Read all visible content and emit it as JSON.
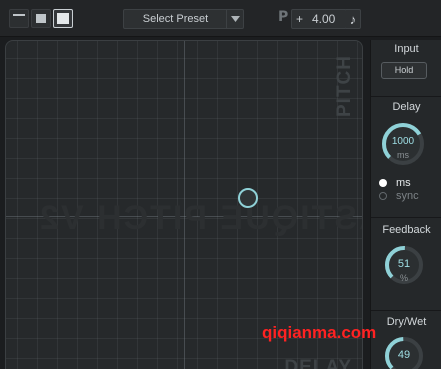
{
  "toolbar": {
    "preset_label": "Select Preset",
    "pitch_prefix": "P",
    "pitch_sign": "+",
    "pitch_value": "4.00",
    "note_symbol": "♪"
  },
  "pad": {
    "y_axis_label": "PITCH",
    "x_axis_label": "DELAY",
    "watermark": "ELASTIQUE PITCH V2"
  },
  "panel": {
    "input": {
      "title": "Input",
      "hold_label": "Hold"
    },
    "delay": {
      "title": "Delay",
      "value": "1000",
      "unit": "ms",
      "fraction": 0.72,
      "mode_options": [
        "ms",
        "sync"
      ],
      "selected_mode": "ms"
    },
    "feedback": {
      "title": "Feedback",
      "value": "51",
      "unit": "%",
      "fraction": 0.51
    },
    "drywet": {
      "title": "Dry/Wet",
      "value": "49",
      "fraction": 0.49
    }
  },
  "overlay": {
    "watermark_text": "qiqianma.com"
  },
  "colors": {
    "accent": "#8fd1d7",
    "overlay_text": "#ff2222",
    "background": "#1b1d1f"
  }
}
